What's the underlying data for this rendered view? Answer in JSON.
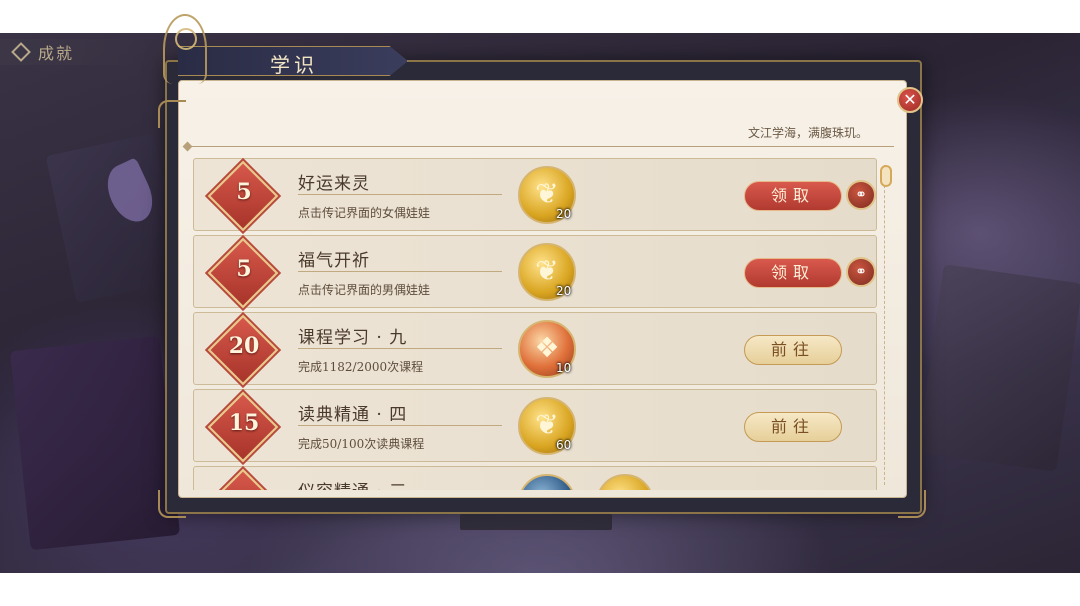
{
  "top_tag": {
    "label": "成就"
  },
  "panel": {
    "title": "学识",
    "motto": "文江学海，满腹珠玑。",
    "close_glyph": "✕"
  },
  "tasks": [
    {
      "points": "5",
      "title": "好运来灵",
      "desc": "点击传记界面的女偶娃娃",
      "reward_icon": "feather-icon",
      "reward_qty": "20",
      "action": "领取",
      "action_state": "claim",
      "share": true
    },
    {
      "points": "5",
      "title": "福气开祈",
      "desc": "点击传记界面的男偶娃娃",
      "reward_icon": "feather-icon",
      "reward_qty": "20",
      "action": "领取",
      "action_state": "claim",
      "share": true
    },
    {
      "points": "20",
      "title": "课程学习 · 九",
      "desc": "完成1182/2000次课程",
      "reward_icon": "crystal-leaf-icon",
      "reward_qty": "10",
      "action": "前往",
      "action_state": "goto",
      "share": false
    },
    {
      "points": "15",
      "title": "读典精通 · 四",
      "desc": "完成50/100次读典课程",
      "reward_icon": "feather-icon",
      "reward_qty": "60",
      "action": "前往",
      "action_state": "goto",
      "share": false
    },
    {
      "points": "",
      "title": "仪容精通 · 三",
      "desc": "",
      "reward_icon": "feather-icon",
      "reward_qty": "",
      "action": "",
      "action_state": "",
      "share": false
    }
  ],
  "glyphs": {
    "feather": "❦",
    "crystal": "❖",
    "share": "⚭"
  },
  "colors": {
    "accent_red": "#b13a30",
    "gold": "#d6b570",
    "panel_dark": "#2b2a38"
  }
}
